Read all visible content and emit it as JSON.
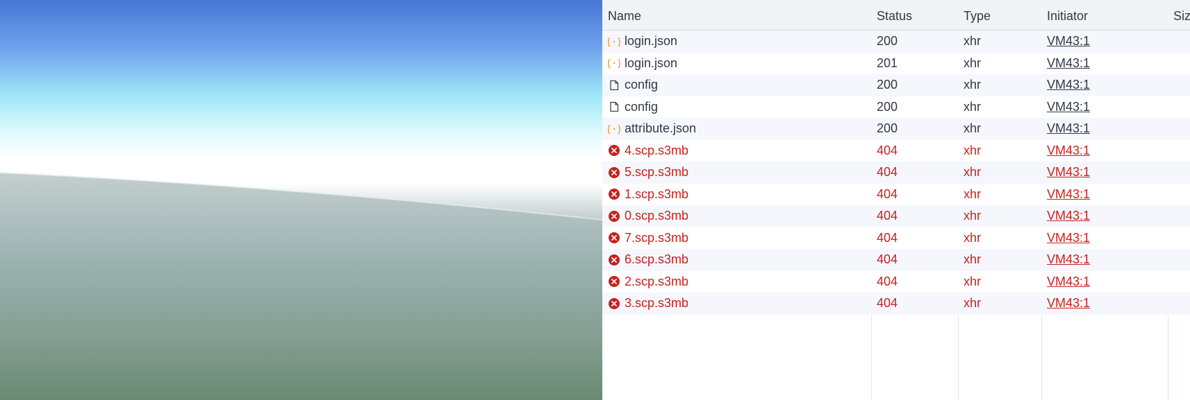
{
  "columns": {
    "name": "Name",
    "status": "Status",
    "type": "Type",
    "initiator": "Initiator",
    "size": "Size"
  },
  "colors": {
    "error": "#c5221f",
    "json_icon": "#f08a24",
    "doc_icon": "#444444"
  },
  "requests": [
    {
      "name": "login.json",
      "status": "200",
      "type": "xhr",
      "initiator": "VM43:1",
      "icon": "json-icon",
      "error": false
    },
    {
      "name": "login.json",
      "status": "201",
      "type": "xhr",
      "initiator": "VM43:1",
      "icon": "json-icon",
      "error": false
    },
    {
      "name": "config",
      "status": "200",
      "type": "xhr",
      "initiator": "VM43:1",
      "icon": "document-icon",
      "error": false
    },
    {
      "name": "config",
      "status": "200",
      "type": "xhr",
      "initiator": "VM43:1",
      "icon": "document-icon",
      "error": false
    },
    {
      "name": "attribute.json",
      "status": "200",
      "type": "xhr",
      "initiator": "VM43:1",
      "icon": "json-icon",
      "error": false
    },
    {
      "name": "4.scp.s3mb",
      "status": "404",
      "type": "xhr",
      "initiator": "VM43:1",
      "icon": "error-icon",
      "error": true
    },
    {
      "name": "5.scp.s3mb",
      "status": "404",
      "type": "xhr",
      "initiator": "VM43:1",
      "icon": "error-icon",
      "error": true
    },
    {
      "name": "1.scp.s3mb",
      "status": "404",
      "type": "xhr",
      "initiator": "VM43:1",
      "icon": "error-icon",
      "error": true
    },
    {
      "name": "0.scp.s3mb",
      "status": "404",
      "type": "xhr",
      "initiator": "VM43:1",
      "icon": "error-icon",
      "error": true
    },
    {
      "name": "7.scp.s3mb",
      "status": "404",
      "type": "xhr",
      "initiator": "VM43:1",
      "icon": "error-icon",
      "error": true
    },
    {
      "name": "6.scp.s3mb",
      "status": "404",
      "type": "xhr",
      "initiator": "VM43:1",
      "icon": "error-icon",
      "error": true
    },
    {
      "name": "2.scp.s3mb",
      "status": "404",
      "type": "xhr",
      "initiator": "VM43:1",
      "icon": "error-icon",
      "error": true
    },
    {
      "name": "3.scp.s3mb",
      "status": "404",
      "type": "xhr",
      "initiator": "VM43:1",
      "icon": "error-icon",
      "error": true
    }
  ]
}
